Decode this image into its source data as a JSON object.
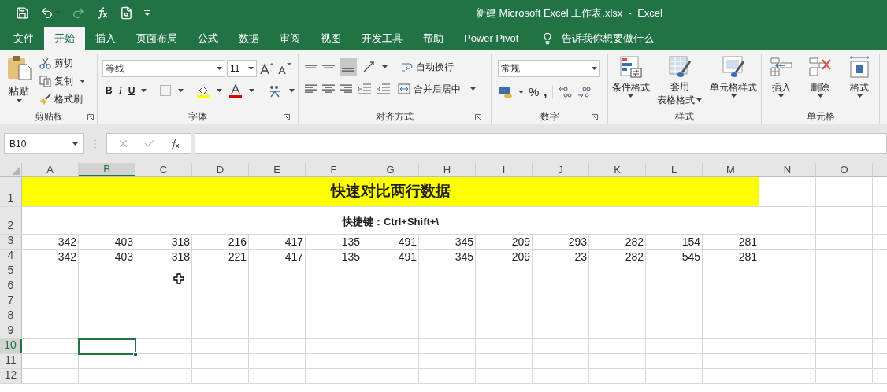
{
  "window": {
    "title": "新建 Microsoft Excel 工作表.xlsx  -  Excel"
  },
  "tabs": [
    {
      "label": "文件",
      "selected": false
    },
    {
      "label": "开始",
      "selected": true
    },
    {
      "label": "插入",
      "selected": false
    },
    {
      "label": "页面布局",
      "selected": false
    },
    {
      "label": "公式",
      "selected": false
    },
    {
      "label": "数据",
      "selected": false
    },
    {
      "label": "审阅",
      "selected": false
    },
    {
      "label": "视图",
      "selected": false
    },
    {
      "label": "开发工具",
      "selected": false
    },
    {
      "label": "帮助",
      "selected": false
    },
    {
      "label": "Power Pivot",
      "selected": false
    }
  ],
  "tell_me": {
    "placeholder": "告诉我你想要做什么"
  },
  "ribbon": {
    "clipboard": {
      "label": "剪贴板",
      "paste": "粘贴",
      "cut": "剪切",
      "copy": "复制",
      "format_painter": "格式刷"
    },
    "font": {
      "label": "字体",
      "font_name": "等线",
      "font_size": "11",
      "bold": "B",
      "italic": "I",
      "underline": "U"
    },
    "alignment": {
      "label": "对齐方式",
      "wrap": "自动换行",
      "merge": "合并后居中"
    },
    "number": {
      "label": "数字",
      "format": "常规",
      "percent": "%",
      "comma": ","
    },
    "styles": {
      "label": "样式",
      "conditional": "条件格式",
      "table_line1": "套用",
      "table_line2": "表格格式",
      "cell_styles": "单元格样式"
    },
    "cells": {
      "label": "单元格",
      "insert": "插入",
      "delete": "删除",
      "format": "格式"
    }
  },
  "formula_bar": {
    "name_box": "B10"
  },
  "columns": [
    {
      "label": "A",
      "selected": false
    },
    {
      "label": "B",
      "selected": true
    },
    {
      "label": "C",
      "selected": false
    },
    {
      "label": "D",
      "selected": false
    },
    {
      "label": "E",
      "selected": false
    },
    {
      "label": "F",
      "selected": false
    },
    {
      "label": "G",
      "selected": false
    },
    {
      "label": "H",
      "selected": false
    },
    {
      "label": "I",
      "selected": false
    },
    {
      "label": "J",
      "selected": false
    },
    {
      "label": "K",
      "selected": false
    },
    {
      "label": "L",
      "selected": false
    },
    {
      "label": "M",
      "selected": false
    },
    {
      "label": "N",
      "selected": false
    },
    {
      "label": "O",
      "selected": false
    }
  ],
  "rows": [
    {
      "label": "1",
      "kind": "banner",
      "text": "快速对比两行数据",
      "selected": false
    },
    {
      "label": "2",
      "kind": "note",
      "text": "快捷键：Ctrl+Shift+\\",
      "selected": false
    },
    {
      "label": "3",
      "kind": "data",
      "values": [
        "342",
        "403",
        "318",
        "216",
        "417",
        "135",
        "491",
        "345",
        "209",
        "293",
        "282",
        "154",
        "281"
      ],
      "selected": false
    },
    {
      "label": "4",
      "kind": "data",
      "values": [
        "342",
        "403",
        "318",
        "221",
        "417",
        "135",
        "491",
        "345",
        "209",
        "23",
        "282",
        "545",
        "281"
      ],
      "selected": false
    },
    {
      "label": "5",
      "kind": "empty",
      "selected": false
    },
    {
      "label": "6",
      "kind": "empty",
      "selected": false
    },
    {
      "label": "7",
      "kind": "empty",
      "selected": false
    },
    {
      "label": "8",
      "kind": "empty",
      "selected": false
    },
    {
      "label": "9",
      "kind": "empty",
      "selected": false
    },
    {
      "label": "10",
      "kind": "empty",
      "selected": true
    },
    {
      "label": "11",
      "kind": "empty",
      "selected": false
    },
    {
      "label": "12",
      "kind": "empty",
      "selected": false
    }
  ]
}
